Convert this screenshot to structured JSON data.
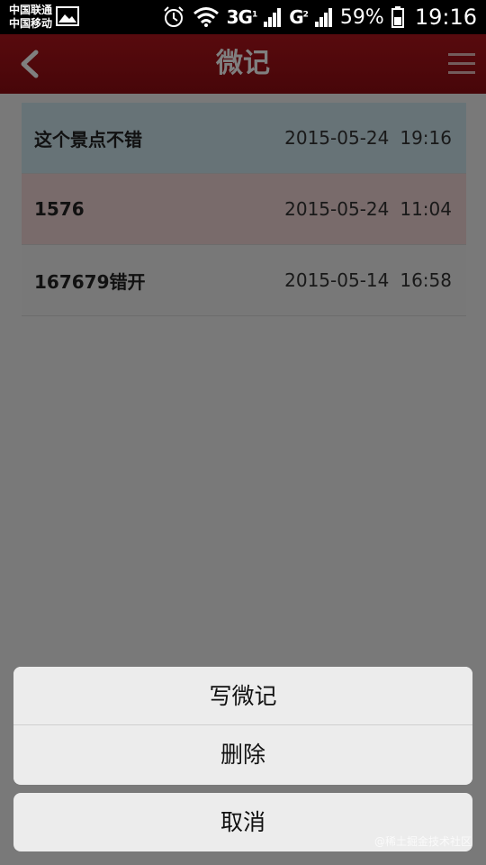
{
  "status_bar": {
    "carrier_1": "中国联通",
    "carrier_2": "中国移动",
    "network_1": "3G",
    "network_2": "G",
    "sim_1": "1",
    "sim_2": "2",
    "battery": "59%",
    "time": "19:16"
  },
  "header": {
    "title": "微记",
    "color": "#a51118"
  },
  "records": [
    {
      "title": "这个景点不错",
      "date": "2015-05-24",
      "time": "19:16"
    },
    {
      "title": "1576",
      "date": "2015-05-24",
      "time": "11:04"
    },
    {
      "title": "167679错开",
      "date": "2015-05-14",
      "time": "16:58"
    }
  ],
  "action_sheet": {
    "write_label": "写微记",
    "delete_label": "删除",
    "cancel_label": "取消"
  },
  "watermark": "@稀土掘金技术社区"
}
